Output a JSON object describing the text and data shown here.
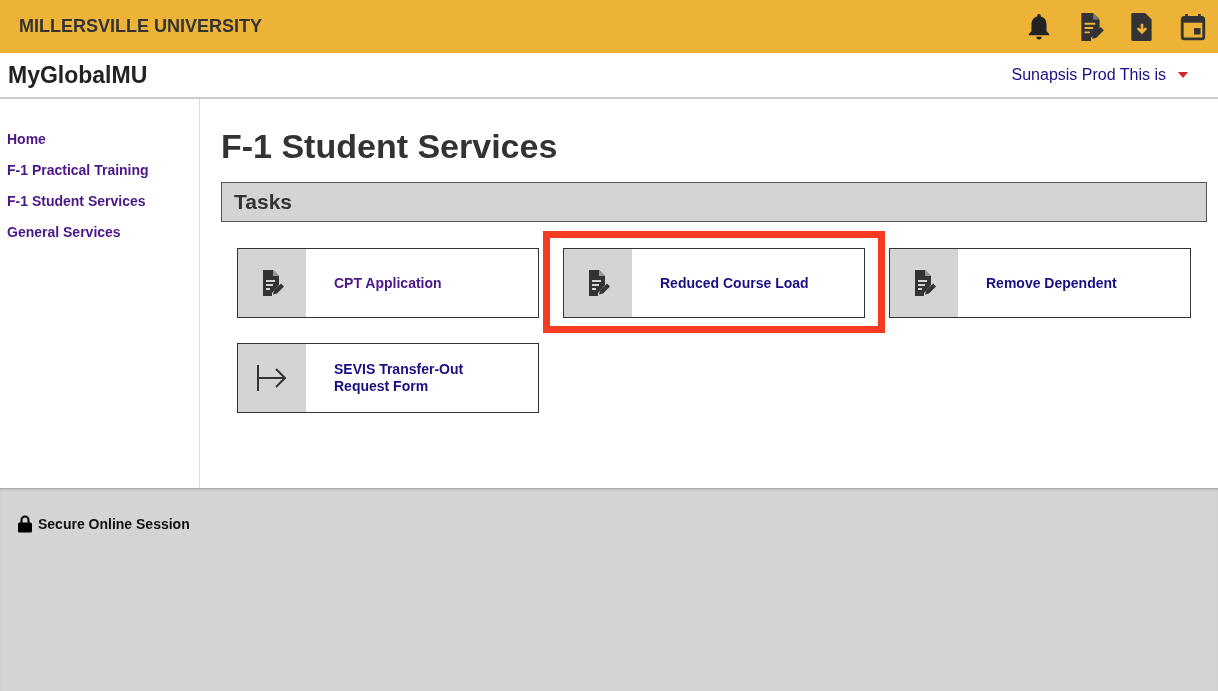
{
  "header": {
    "university": "MILLERSVILLE UNIVERSITY"
  },
  "subheader": {
    "portal_title": "MyGlobalMU",
    "user_menu": "Sunapsis Prod This is"
  },
  "sidebar": {
    "items": [
      {
        "label": "Home"
      },
      {
        "label": "F-1 Practical Training"
      },
      {
        "label": "F-1 Student Services"
      },
      {
        "label": "General Services"
      }
    ]
  },
  "page": {
    "title": "F-1 Student Services",
    "section_title": "Tasks",
    "tasks": [
      {
        "label": "CPT Application",
        "kind": "form",
        "visited": true,
        "highlighted": false
      },
      {
        "label": "Reduced Course Load",
        "kind": "form",
        "visited": false,
        "highlighted": true
      },
      {
        "label": "Remove Dependent",
        "kind": "form",
        "visited": false,
        "highlighted": false
      },
      {
        "label": "SEVIS Transfer-Out Request Form",
        "kind": "transfer",
        "visited": false,
        "highlighted": false
      }
    ]
  },
  "footer": {
    "text": "Secure Online Session"
  }
}
